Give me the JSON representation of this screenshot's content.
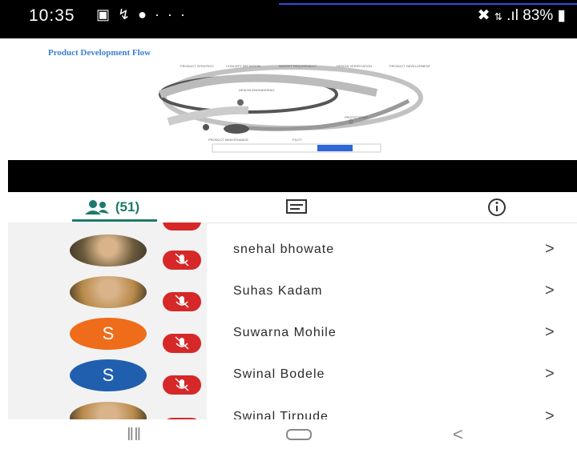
{
  "status_bar": {
    "time": "10:35",
    "left_icons": [
      "gallery-icon",
      "missed-call-icon",
      "whatsapp-icon",
      "more-dots-icon"
    ],
    "battery": "83%",
    "right_icons": [
      "mute-icon",
      "data-icon",
      "signal-icon",
      "battery-icon"
    ]
  },
  "shared_slide": {
    "title": "Product Development Flow"
  },
  "tabs": {
    "participants_count": "(51)",
    "chat_icon": "chat-icon",
    "info_icon": "info-icon"
  },
  "participants": [
    {
      "name": "snehal bhowate",
      "avatar": "photo",
      "muted": true
    },
    {
      "name": "Suhas Kadam",
      "avatar": "photo",
      "muted": true
    },
    {
      "name": "Suwarna Mohile",
      "avatar": "letter",
      "letter": "S",
      "color": "#ef6c1a",
      "muted": true
    },
    {
      "name": "Swinal Bodele",
      "avatar": "letter",
      "letter": "S",
      "color": "#1f5fae",
      "muted": true
    },
    {
      "name": "Swinal Tirpude",
      "avatar": "photo",
      "muted": true
    }
  ],
  "nav": {
    "recents": "recents-icon",
    "home": "home-icon",
    "back": "back-icon"
  },
  "colors": {
    "accent": "#1d7a6c",
    "mute_badge": "#d62828"
  }
}
